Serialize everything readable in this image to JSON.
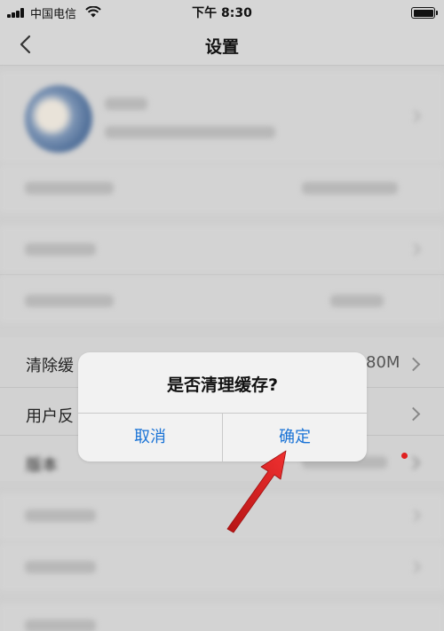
{
  "status_bar": {
    "carrier": "中国电信",
    "time": "下午 8:30"
  },
  "nav": {
    "title": "设置"
  },
  "rows": {
    "clear_cache": {
      "label": "清除缓",
      "value": "80M"
    },
    "feedback": {
      "label": "用户反"
    },
    "version": {
      "label": "版本"
    }
  },
  "dialog": {
    "title": "是否清理缓存?",
    "cancel": "取消",
    "confirm": "确定"
  },
  "colors": {
    "accent": "#1a73d6",
    "badge": "#e02020",
    "annotation_arrow": "#e41e1e"
  },
  "icons": [
    "signal-icon",
    "wifi-icon",
    "battery-icon",
    "back-icon",
    "chevron-right-icon",
    "red-arrow-annotation"
  ]
}
